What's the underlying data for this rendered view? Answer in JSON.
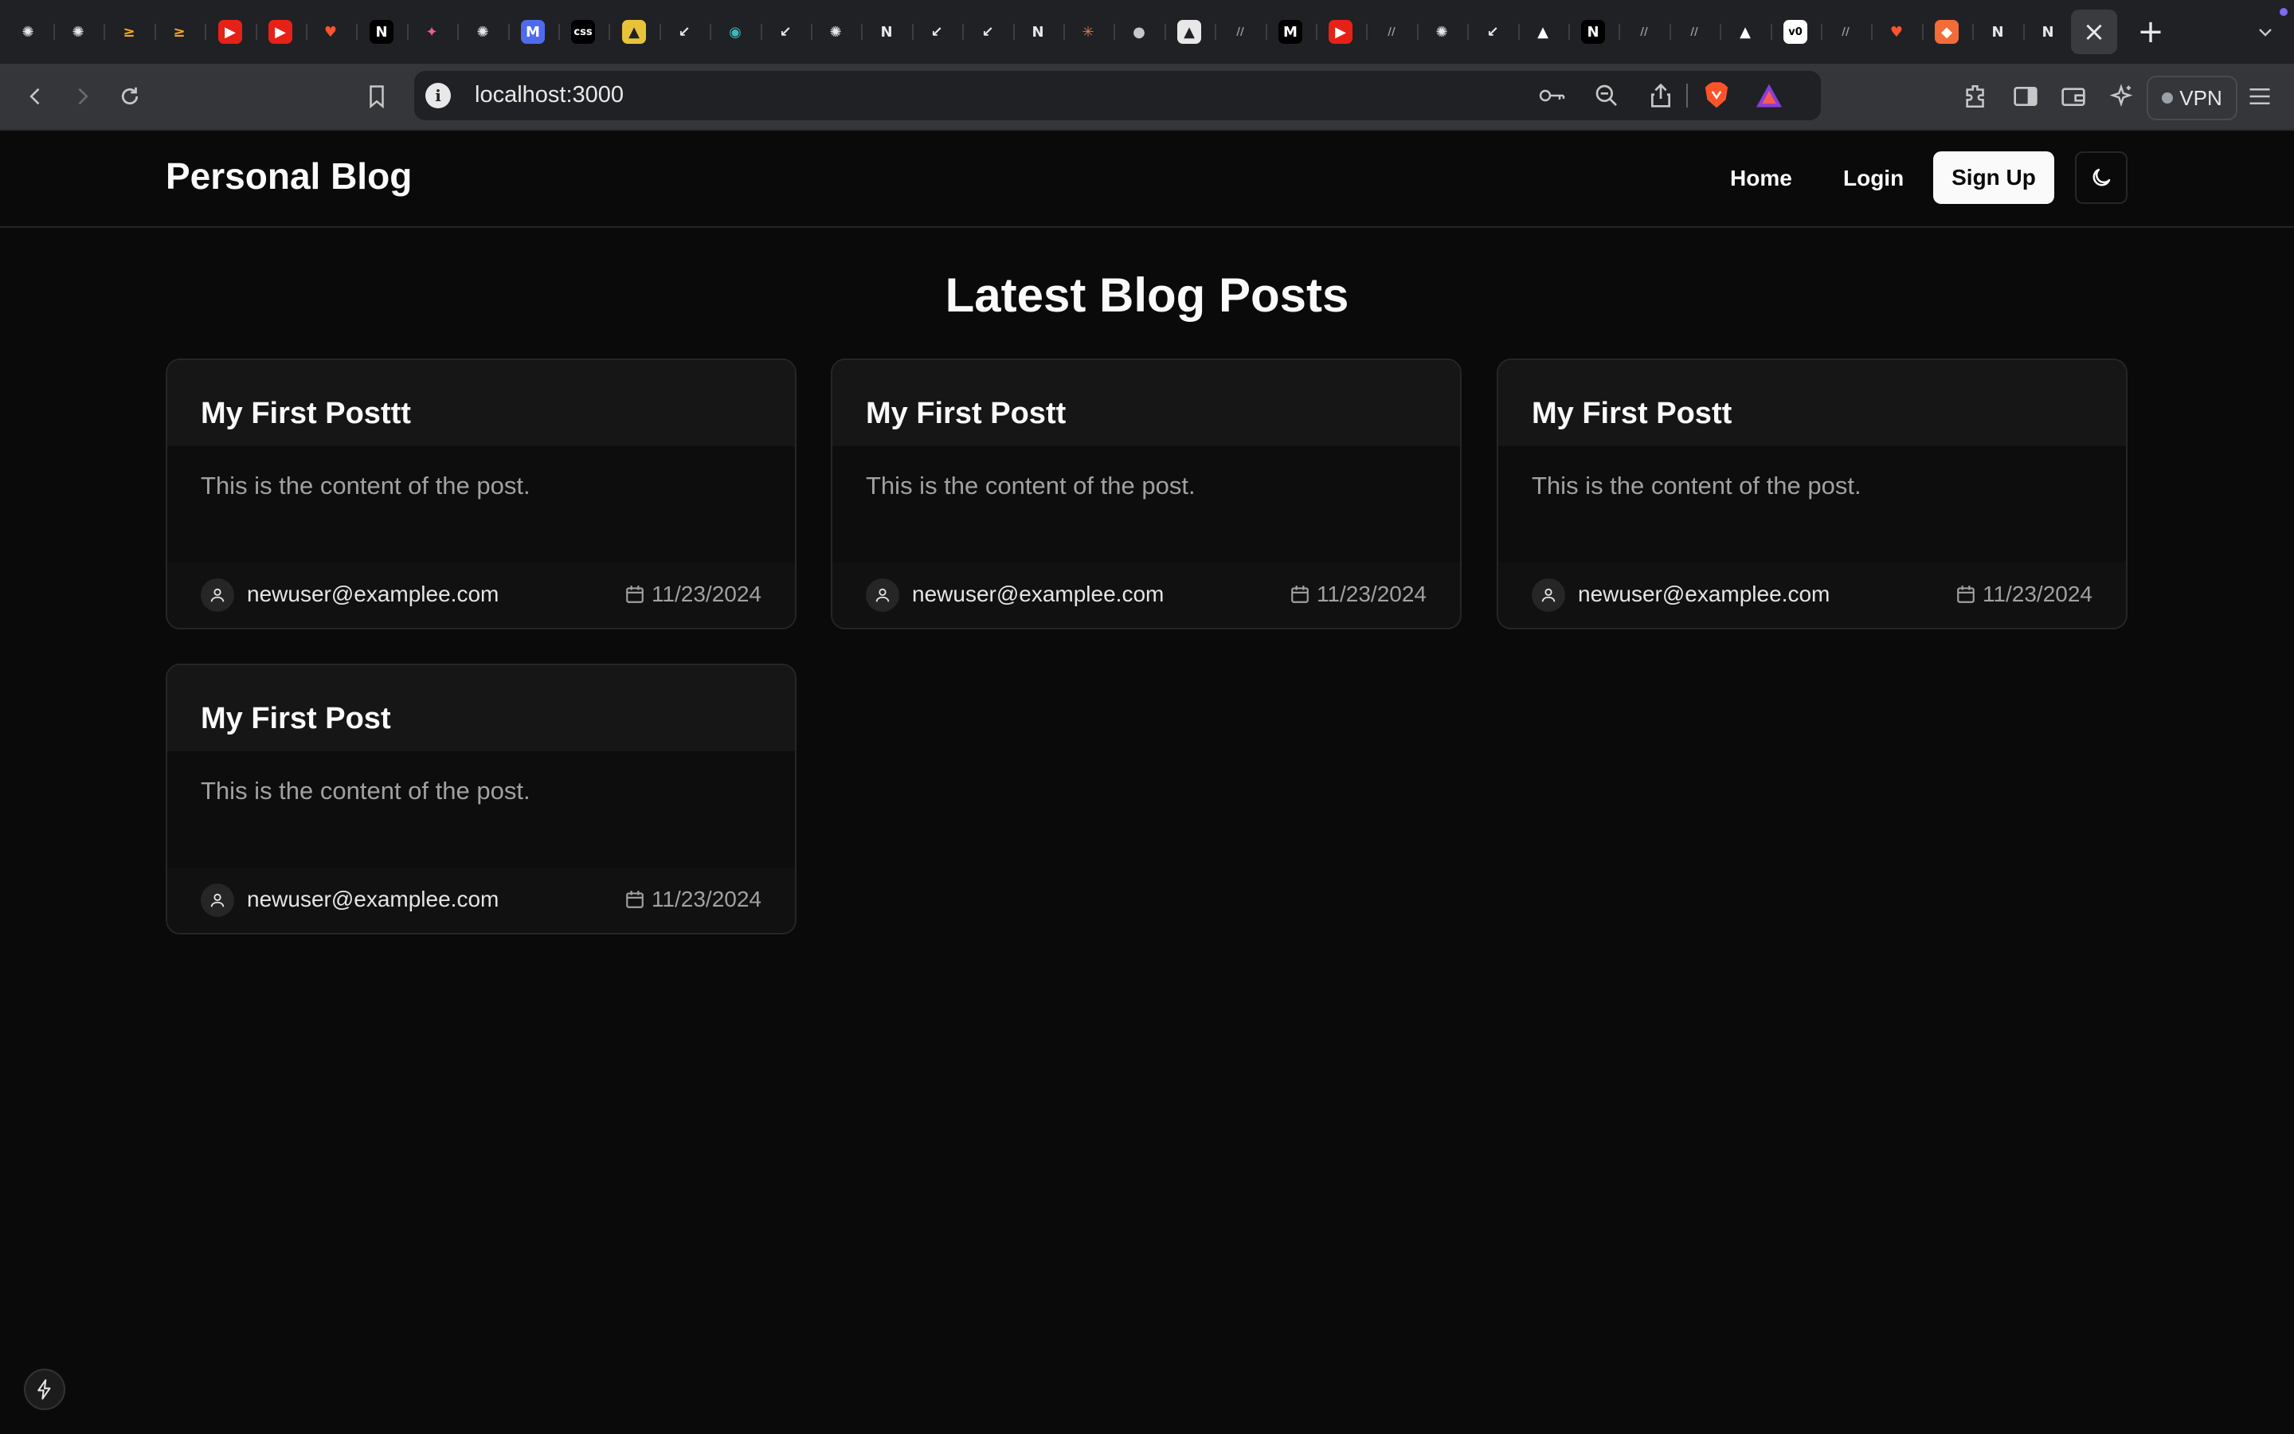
{
  "browser": {
    "tabs": [
      {
        "icon": "openai-icon",
        "glyph": "✺",
        "bg": "#202124",
        "fg": "#e8e8e8"
      },
      {
        "icon": "openai-icon",
        "glyph": "✺",
        "bg": "#202124",
        "fg": "#e8e8e8"
      },
      {
        "icon": "aws-icon",
        "glyph": "≥",
        "bg": "#202124",
        "fg": "#f5a623"
      },
      {
        "icon": "aws-icon",
        "glyph": "≥",
        "bg": "#202124",
        "fg": "#f5a623"
      },
      {
        "icon": "youtube-icon",
        "glyph": "▶",
        "bg": "#e62117",
        "fg": "#ffffff"
      },
      {
        "icon": "youtube-icon",
        "glyph": "▶",
        "bg": "#e62117",
        "fg": "#ffffff"
      },
      {
        "icon": "brave-icon",
        "glyph": "♥",
        "bg": "#202124",
        "fg": "#fb542b"
      },
      {
        "icon": "nextjs-icon",
        "glyph": "N",
        "bg": "#000000",
        "fg": "#ffffff"
      },
      {
        "icon": "sock-icon",
        "glyph": "✦",
        "bg": "#202124",
        "fg": "#e85d9c"
      },
      {
        "icon": "openai-icon",
        "glyph": "✺",
        "bg": "#202124",
        "fg": "#e8e8e8"
      },
      {
        "icon": "m-icon",
        "glyph": "M",
        "bg": "#4f6bed",
        "fg": "#ffffff"
      },
      {
        "icon": "css-icon",
        "glyph": "css",
        "bg": "#000000",
        "fg": "#ffffff"
      },
      {
        "icon": "image-icon",
        "glyph": "▲",
        "bg": "#e8c33a",
        "fg": "#202124"
      },
      {
        "icon": "kit-icon",
        "glyph": "↙",
        "bg": "#202124",
        "fg": "#e8e8e8"
      },
      {
        "icon": "eye-icon",
        "glyph": "◉",
        "bg": "#202124",
        "fg": "#3fb7b7"
      },
      {
        "icon": "kit-icon",
        "glyph": "↙",
        "bg": "#202124",
        "fg": "#e8e8e8"
      },
      {
        "icon": "openai-icon",
        "glyph": "✺",
        "bg": "#202124",
        "fg": "#e8e8e8"
      },
      {
        "icon": "notion-icon",
        "glyph": "N",
        "bg": "#202124",
        "fg": "#e8e8e8"
      },
      {
        "icon": "kit-icon",
        "glyph": "↙",
        "bg": "#202124",
        "fg": "#e8e8e8"
      },
      {
        "icon": "kit-icon",
        "glyph": "↙",
        "bg": "#202124",
        "fg": "#e8e8e8"
      },
      {
        "icon": "notion-icon",
        "glyph": "N",
        "bg": "#202124",
        "fg": "#e8e8e8"
      },
      {
        "icon": "claude-icon",
        "glyph": "✳",
        "bg": "#202124",
        "fg": "#d97757"
      },
      {
        "icon": "globe-icon",
        "glyph": "●",
        "bg": "#202124",
        "fg": "#c7c7c7"
      },
      {
        "icon": "vercel-icon",
        "glyph": "▲",
        "bg": "#e8e8e8",
        "fg": "#202124"
      },
      {
        "icon": "slash-icon",
        "glyph": "//",
        "bg": "#202124",
        "fg": "#9aa0a6"
      },
      {
        "icon": "medium-icon",
        "glyph": "M",
        "bg": "#000000",
        "fg": "#ffffff"
      },
      {
        "icon": "youtube-icon",
        "glyph": "▶",
        "bg": "#e62117",
        "fg": "#ffffff"
      },
      {
        "icon": "slash-icon",
        "glyph": "//",
        "bg": "#202124",
        "fg": "#9aa0a6"
      },
      {
        "icon": "openai-icon",
        "glyph": "✺",
        "bg": "#202124",
        "fg": "#e8e8e8"
      },
      {
        "icon": "kit-icon",
        "glyph": "↙",
        "bg": "#202124",
        "fg": "#e8e8e8"
      },
      {
        "icon": "vercel-icon",
        "glyph": "▲",
        "bg": "#202124",
        "fg": "#ffffff"
      },
      {
        "icon": "nextjs-icon",
        "glyph": "N",
        "bg": "#000000",
        "fg": "#ffffff"
      },
      {
        "icon": "slash-icon",
        "glyph": "//",
        "bg": "#202124",
        "fg": "#9aa0a6"
      },
      {
        "icon": "slash-icon",
        "glyph": "//",
        "bg": "#202124",
        "fg": "#9aa0a6"
      },
      {
        "icon": "vercel-icon",
        "glyph": "▲",
        "bg": "#202124",
        "fg": "#ffffff"
      },
      {
        "icon": "v0-icon",
        "glyph": "v0",
        "bg": "#ffffff",
        "fg": "#000000"
      },
      {
        "icon": "slash-icon",
        "glyph": "//",
        "bg": "#202124",
        "fg": "#9aa0a6"
      },
      {
        "icon": "brave-icon",
        "glyph": "♥",
        "bg": "#202124",
        "fg": "#fb542b"
      },
      {
        "icon": "brave-talk-icon",
        "glyph": "◆",
        "bg": "#f26b38",
        "fg": "#ffffff"
      },
      {
        "icon": "notion-icon",
        "glyph": "N",
        "bg": "#202124",
        "fg": "#e8e8e8"
      },
      {
        "icon": "notion-icon",
        "glyph": "N",
        "bg": "#202124",
        "fg": "#e8e8e8"
      }
    ],
    "address": "localhost:3000",
    "vpn_label": "VPN"
  },
  "site": {
    "brand": "Personal Blog",
    "nav": {
      "home": "Home",
      "login": "Login",
      "signup": "Sign Up"
    },
    "page_title": "Latest Blog Posts"
  },
  "posts": [
    {
      "title": "My First Posttt",
      "content": "This is the content of the post.",
      "author": "newuser@examplee.com",
      "date": "11/23/2024"
    },
    {
      "title": "My First Postt",
      "content": "This is the content of the post.",
      "author": "newuser@examplee.com",
      "date": "11/23/2024"
    },
    {
      "title": "My First Postt",
      "content": "This is the content of the post.",
      "author": "newuser@examplee.com",
      "date": "11/23/2024"
    },
    {
      "title": "My First Post",
      "content": "This is the content of the post.",
      "author": "newuser@examplee.com",
      "date": "11/23/2024"
    }
  ]
}
